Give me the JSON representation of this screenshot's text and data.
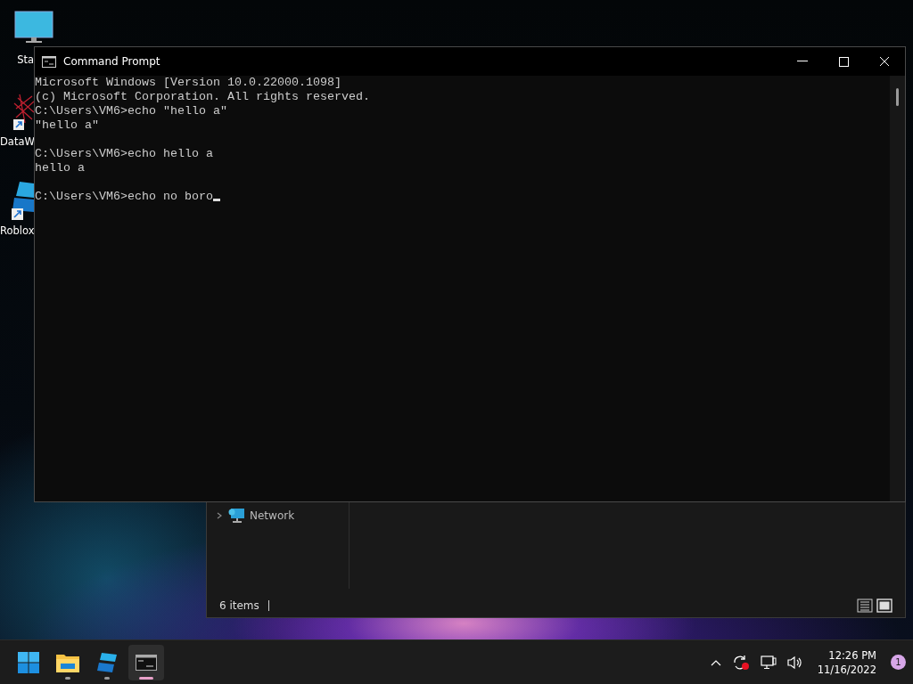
{
  "desktop_icons": [
    {
      "kind": "monitor",
      "label": "Sta"
    },
    {
      "kind": "scribble",
      "label": "DataW"
    },
    {
      "kind": "roblox",
      "label": "Roblox"
    }
  ],
  "console": {
    "title": "Command Prompt",
    "blocks": [
      [
        "Microsoft Windows [Version 10.0.22000.1098]",
        "(c) Microsoft Corporation. All rights reserved.",
        "C:\\Users\\VM6>echo \"hello a\"",
        "\"hello a\""
      ],
      [
        "C:\\Users\\VM6>echo hello a",
        "hello a"
      ],
      [
        "C:\\Users\\VM6>echo no boro"
      ]
    ]
  },
  "explorer": {
    "nav_items": [
      {
        "label": "Network",
        "expanded": false
      }
    ],
    "status": "6 items"
  },
  "taskbar": {
    "apps": [
      {
        "kind": "start",
        "running": false,
        "active": false
      },
      {
        "kind": "folder",
        "running": true,
        "active": false
      },
      {
        "kind": "roblox",
        "running": true,
        "active": false
      },
      {
        "kind": "terminal",
        "running": true,
        "active": true
      }
    ],
    "time": "12:26 PM",
    "date": "11/16/2022",
    "notifications": "1"
  }
}
